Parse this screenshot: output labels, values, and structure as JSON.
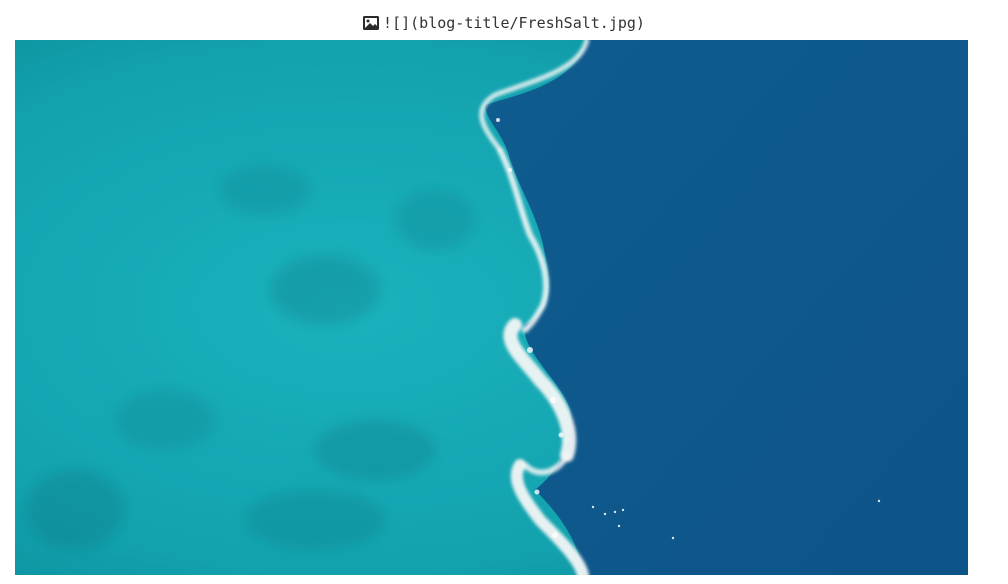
{
  "markdown_image": {
    "source_text": "![](blog-title/FreshSalt.jpg)",
    "icon": "image-icon"
  },
  "image": {
    "alt": "",
    "src_text": "blog-title/FreshSalt.jpg",
    "description_colors": {
      "turquoise_water": "#14a5b2",
      "deep_blue_water": "#0e5b8e",
      "foam": "#f4f8f8"
    }
  }
}
